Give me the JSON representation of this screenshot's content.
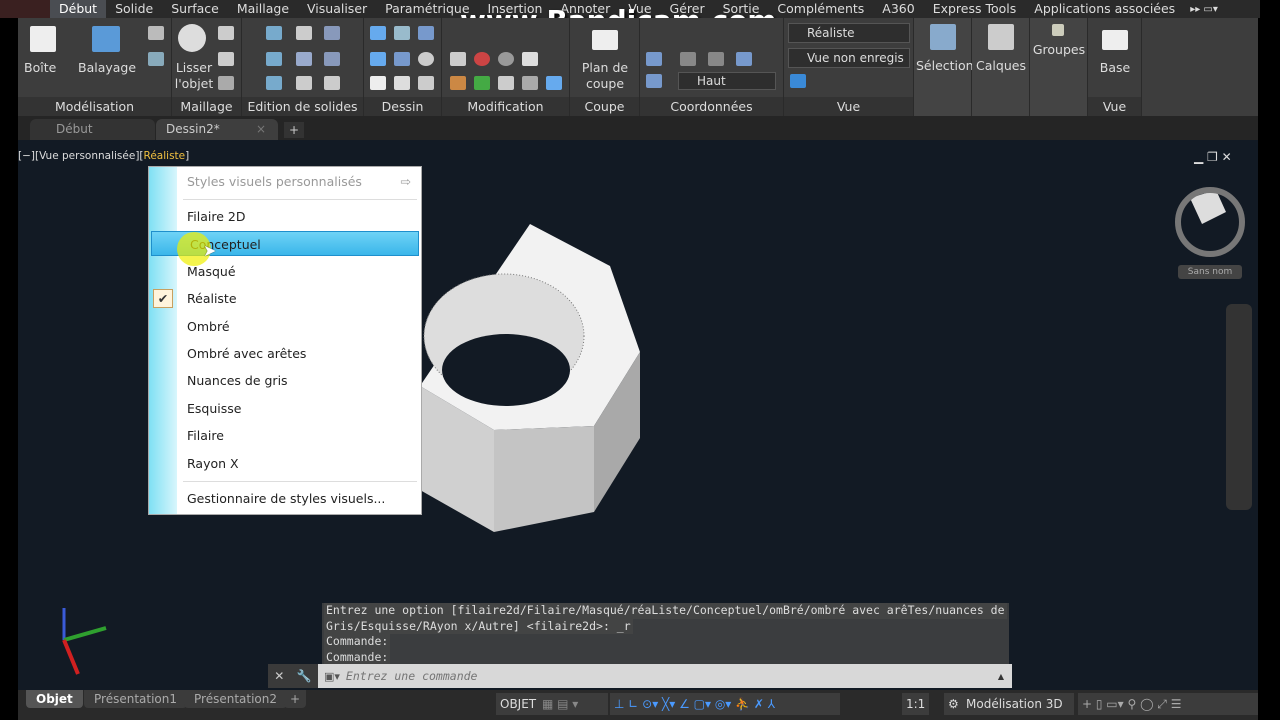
{
  "ribbon_tabs": [
    "Début",
    "Solide",
    "Surface",
    "Maillage",
    "Visualiser",
    "Paramétrique",
    "Insertion",
    "Annoter",
    "Vue",
    "Gérer",
    "Sortie",
    "Compléments",
    "A360",
    "Express Tools",
    "Applications associées"
  ],
  "panels": {
    "modelisation": "Modélisation",
    "maillage": "Maillage",
    "edition": "Edition de solides",
    "dessin": "Dessin",
    "modification": "Modification",
    "coupe": "Coupe",
    "coordonnees": "Coordonnées",
    "vue": "Vue",
    "vue2": "Vue"
  },
  "big_buttons": {
    "boite": "Boîte",
    "balayage": "Balayage",
    "lisser": "Lisser l'objet",
    "plan": "Plan de coupe",
    "selection": "Sélection",
    "calques": "Calques",
    "groupes": "Groupes",
    "base": "Base"
  },
  "dropdowns": {
    "visual_style": "Réaliste",
    "view": "Vue non enregis",
    "ucs": "Haut"
  },
  "file_tabs": [
    "Début",
    "Dessin2*"
  ],
  "viewport_label": {
    "prefix": "[−][Vue personnalisée][",
    "style": "Réaliste",
    "suffix": "]"
  },
  "viewcube_label": "Sans nom",
  "watermark": "www.Bandicam.com",
  "menu": {
    "header": "Styles visuels personnalisés",
    "items": [
      "Filaire 2D",
      "Conceptuel",
      "Masqué",
      "Réaliste",
      "Ombré",
      "Ombré avec arêtes",
      "Nuances de gris",
      "Esquisse",
      "Filaire",
      "Rayon X"
    ],
    "highlighted": "Conceptuel",
    "checked": "Réaliste",
    "footer": "Gestionnaire de styles visuels..."
  },
  "command_history": [
    "Entrez une option [filaire2d/Filaire/Masqué/réaListe/Conceptuel/omBré/ombré avec arêTes/nuances de",
    "Gris/Esquisse/RAyon x/Autre] <filaire2d>: _r",
    "Commande:",
    "Commande:"
  ],
  "command_placeholder": "Entrez une commande",
  "layout_tabs": [
    "Objet",
    "Présentation1",
    "Présentation2"
  ],
  "status": {
    "model": "OBJET",
    "scale": "1:1",
    "workspace": "Modélisation 3D"
  },
  "colors": {
    "accent": "#3ab6ea",
    "viewport_bg": "#121a24"
  }
}
